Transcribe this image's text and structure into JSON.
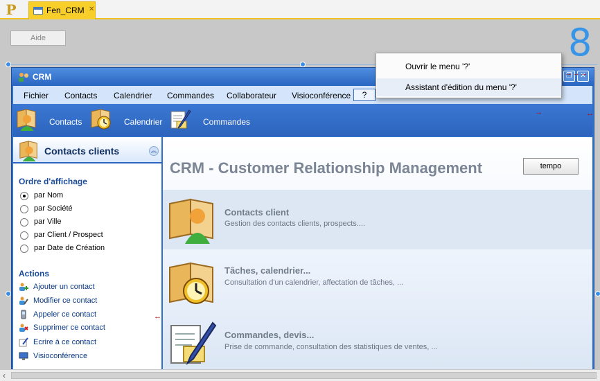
{
  "editor": {
    "logo": "P",
    "active_tab": "Fen_CRM",
    "aide_button": "Aide",
    "indicator": "8"
  },
  "window": {
    "title": "CRM",
    "menu": [
      "Fichier",
      "Contacts",
      "Calendrier",
      "Commandes",
      "Collaborateur",
      "Visioconférence",
      "?"
    ],
    "toolbar": [
      "Contacts",
      "Calendrier",
      "Commandes"
    ]
  },
  "context_menu": {
    "items": [
      "Ouvrir le menu '?'",
      "Assistant d'édition du menu '?'"
    ]
  },
  "left_panel": {
    "title": "Contacts clients",
    "order_heading": "Ordre d'affichage",
    "order_options": [
      "par Nom",
      "par Société",
      "par Ville",
      "par Client / Prospect",
      "par Date de Création"
    ],
    "selected_order": "par Nom",
    "actions_heading": "Actions",
    "actions": [
      "Ajouter un contact",
      "Modifier ce contact",
      "Appeler ce contact",
      "Supprimer ce contact",
      "Ecrire à ce contact",
      "Visioconférence"
    ]
  },
  "main": {
    "title": "CRM - Customer Relationship Management",
    "tempo_button": "tempo",
    "features": [
      {
        "title": "Contacts client",
        "desc": "Gestion des contacts clients, prospects...."
      },
      {
        "title": "Tâches, calendrier...",
        "desc": "Consultation d'un calendrier, affectation de tâches, ..."
      },
      {
        "title": "Commandes, devis...",
        "desc": "Prise de commande, consultation des statistiques de ventes, ..."
      }
    ]
  }
}
